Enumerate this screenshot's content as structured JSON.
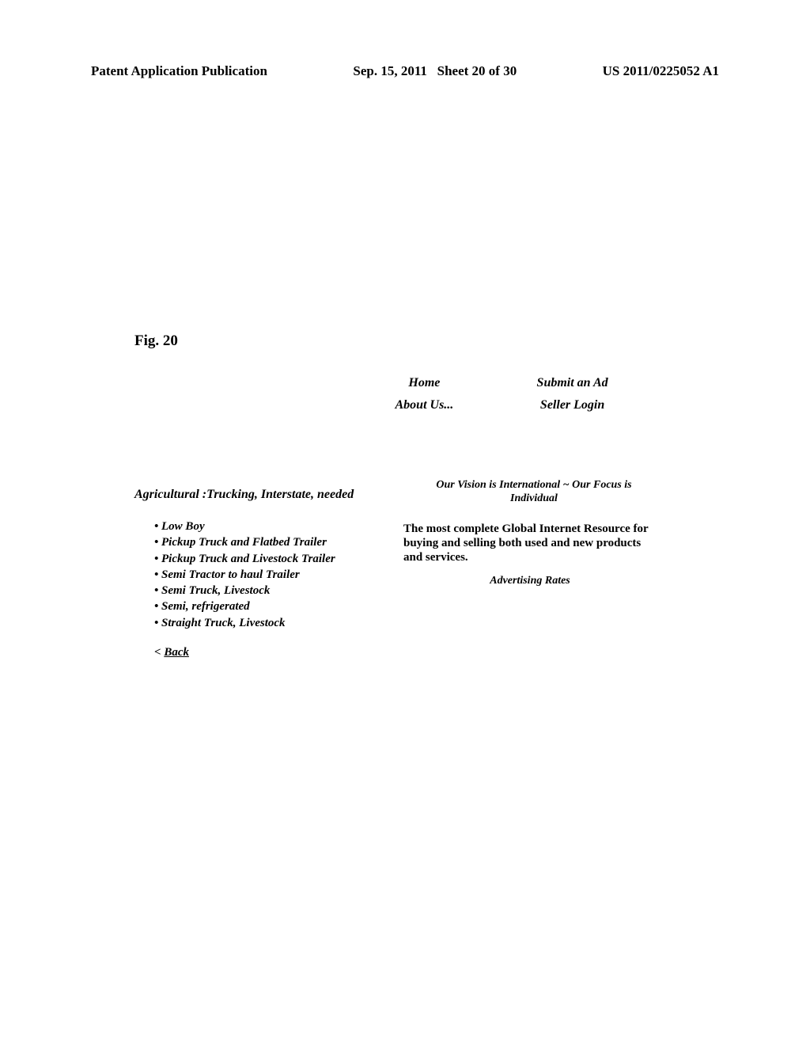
{
  "header": {
    "left": "Patent Application Publication",
    "center": "Sep. 15, 2011   Sheet 20 of 30",
    "right": "US 2011/0225052 A1"
  },
  "figure_label": "Fig. 20",
  "nav": {
    "home": "Home",
    "submit": "Submit an Ad",
    "about": "About Us...",
    "login": "Seller Login"
  },
  "category": {
    "heading": "Agricultural :Trucking, Interstate, needed",
    "items": [
      "Low Boy",
      "Pickup Truck and Flatbed Trailer",
      "Pickup Truck and Livestock Trailer",
      "Semi Tractor to haul Trailer",
      "Semi Truck, Livestock",
      "Semi, refrigerated",
      "Straight Truck, Livestock"
    ],
    "back_prefix": "< ",
    "back_label": "Back"
  },
  "right_panel": {
    "tagline": "Our Vision is International ~ Our Focus is Individual",
    "blurb": "The most complete Global Internet Resource for buying and selling both used and new products and services.",
    "ad_rates": "Advertising Rates"
  }
}
